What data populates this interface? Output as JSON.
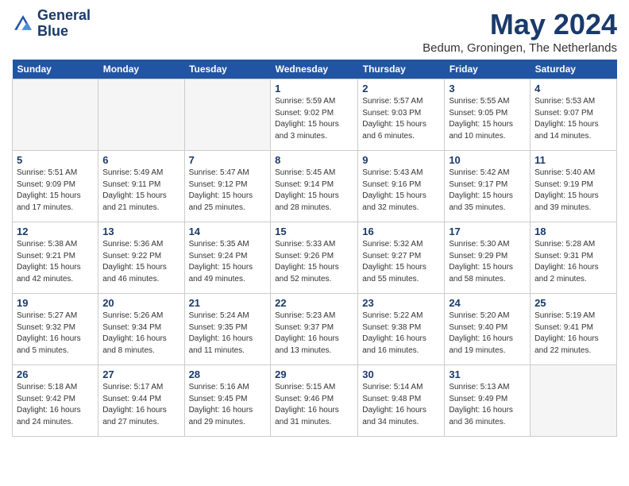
{
  "header": {
    "logo_line1": "General",
    "logo_line2": "Blue",
    "month": "May 2024",
    "location": "Bedum, Groningen, The Netherlands"
  },
  "weekdays": [
    "Sunday",
    "Monday",
    "Tuesday",
    "Wednesday",
    "Thursday",
    "Friday",
    "Saturday"
  ],
  "weeks": [
    [
      {
        "day": "",
        "info": ""
      },
      {
        "day": "",
        "info": ""
      },
      {
        "day": "",
        "info": ""
      },
      {
        "day": "1",
        "info": "Sunrise: 5:59 AM\nSunset: 9:02 PM\nDaylight: 15 hours\nand 3 minutes."
      },
      {
        "day": "2",
        "info": "Sunrise: 5:57 AM\nSunset: 9:03 PM\nDaylight: 15 hours\nand 6 minutes."
      },
      {
        "day": "3",
        "info": "Sunrise: 5:55 AM\nSunset: 9:05 PM\nDaylight: 15 hours\nand 10 minutes."
      },
      {
        "day": "4",
        "info": "Sunrise: 5:53 AM\nSunset: 9:07 PM\nDaylight: 15 hours\nand 14 minutes."
      }
    ],
    [
      {
        "day": "5",
        "info": "Sunrise: 5:51 AM\nSunset: 9:09 PM\nDaylight: 15 hours\nand 17 minutes."
      },
      {
        "day": "6",
        "info": "Sunrise: 5:49 AM\nSunset: 9:11 PM\nDaylight: 15 hours\nand 21 minutes."
      },
      {
        "day": "7",
        "info": "Sunrise: 5:47 AM\nSunset: 9:12 PM\nDaylight: 15 hours\nand 25 minutes."
      },
      {
        "day": "8",
        "info": "Sunrise: 5:45 AM\nSunset: 9:14 PM\nDaylight: 15 hours\nand 28 minutes."
      },
      {
        "day": "9",
        "info": "Sunrise: 5:43 AM\nSunset: 9:16 PM\nDaylight: 15 hours\nand 32 minutes."
      },
      {
        "day": "10",
        "info": "Sunrise: 5:42 AM\nSunset: 9:17 PM\nDaylight: 15 hours\nand 35 minutes."
      },
      {
        "day": "11",
        "info": "Sunrise: 5:40 AM\nSunset: 9:19 PM\nDaylight: 15 hours\nand 39 minutes."
      }
    ],
    [
      {
        "day": "12",
        "info": "Sunrise: 5:38 AM\nSunset: 9:21 PM\nDaylight: 15 hours\nand 42 minutes."
      },
      {
        "day": "13",
        "info": "Sunrise: 5:36 AM\nSunset: 9:22 PM\nDaylight: 15 hours\nand 46 minutes."
      },
      {
        "day": "14",
        "info": "Sunrise: 5:35 AM\nSunset: 9:24 PM\nDaylight: 15 hours\nand 49 minutes."
      },
      {
        "day": "15",
        "info": "Sunrise: 5:33 AM\nSunset: 9:26 PM\nDaylight: 15 hours\nand 52 minutes."
      },
      {
        "day": "16",
        "info": "Sunrise: 5:32 AM\nSunset: 9:27 PM\nDaylight: 15 hours\nand 55 minutes."
      },
      {
        "day": "17",
        "info": "Sunrise: 5:30 AM\nSunset: 9:29 PM\nDaylight: 15 hours\nand 58 minutes."
      },
      {
        "day": "18",
        "info": "Sunrise: 5:28 AM\nSunset: 9:31 PM\nDaylight: 16 hours\nand 2 minutes."
      }
    ],
    [
      {
        "day": "19",
        "info": "Sunrise: 5:27 AM\nSunset: 9:32 PM\nDaylight: 16 hours\nand 5 minutes."
      },
      {
        "day": "20",
        "info": "Sunrise: 5:26 AM\nSunset: 9:34 PM\nDaylight: 16 hours\nand 8 minutes."
      },
      {
        "day": "21",
        "info": "Sunrise: 5:24 AM\nSunset: 9:35 PM\nDaylight: 16 hours\nand 11 minutes."
      },
      {
        "day": "22",
        "info": "Sunrise: 5:23 AM\nSunset: 9:37 PM\nDaylight: 16 hours\nand 13 minutes."
      },
      {
        "day": "23",
        "info": "Sunrise: 5:22 AM\nSunset: 9:38 PM\nDaylight: 16 hours\nand 16 minutes."
      },
      {
        "day": "24",
        "info": "Sunrise: 5:20 AM\nSunset: 9:40 PM\nDaylight: 16 hours\nand 19 minutes."
      },
      {
        "day": "25",
        "info": "Sunrise: 5:19 AM\nSunset: 9:41 PM\nDaylight: 16 hours\nand 22 minutes."
      }
    ],
    [
      {
        "day": "26",
        "info": "Sunrise: 5:18 AM\nSunset: 9:42 PM\nDaylight: 16 hours\nand 24 minutes."
      },
      {
        "day": "27",
        "info": "Sunrise: 5:17 AM\nSunset: 9:44 PM\nDaylight: 16 hours\nand 27 minutes."
      },
      {
        "day": "28",
        "info": "Sunrise: 5:16 AM\nSunset: 9:45 PM\nDaylight: 16 hours\nand 29 minutes."
      },
      {
        "day": "29",
        "info": "Sunrise: 5:15 AM\nSunset: 9:46 PM\nDaylight: 16 hours\nand 31 minutes."
      },
      {
        "day": "30",
        "info": "Sunrise: 5:14 AM\nSunset: 9:48 PM\nDaylight: 16 hours\nand 34 minutes."
      },
      {
        "day": "31",
        "info": "Sunrise: 5:13 AM\nSunset: 9:49 PM\nDaylight: 16 hours\nand 36 minutes."
      },
      {
        "day": "",
        "info": ""
      }
    ]
  ]
}
